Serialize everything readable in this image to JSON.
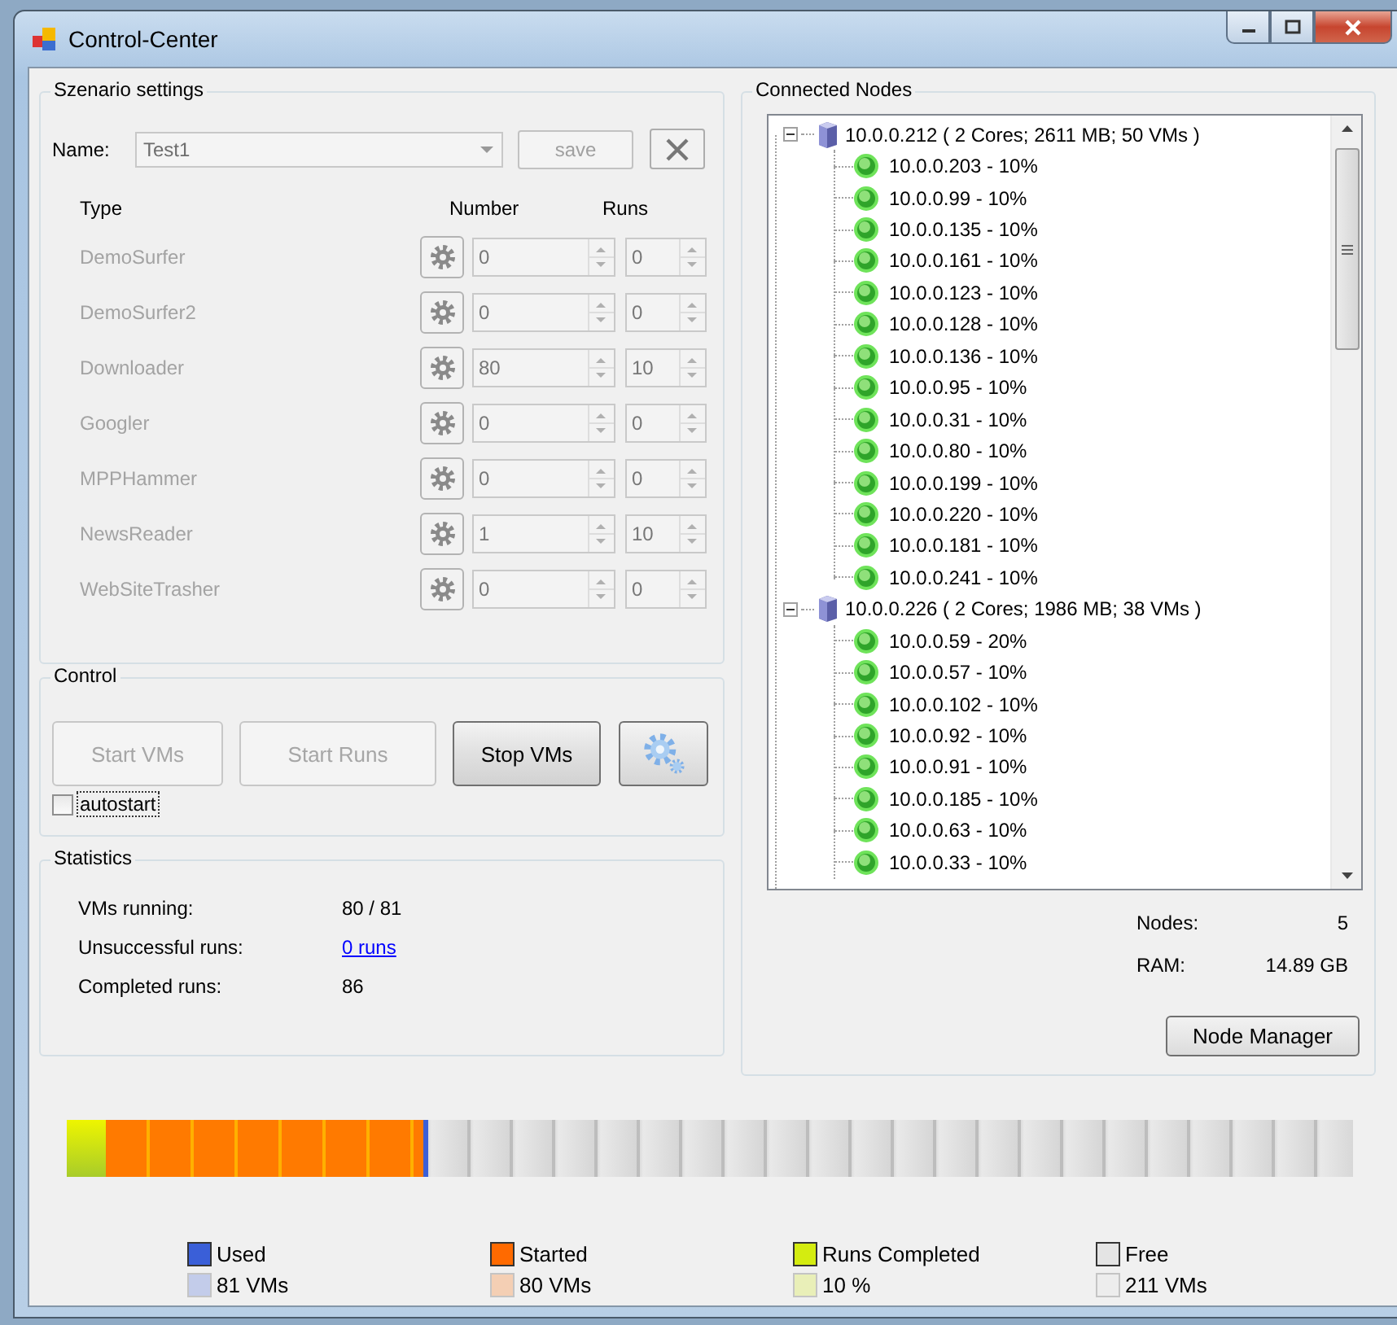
{
  "window": {
    "title": "Control-Center"
  },
  "scenario": {
    "title": "Szenario settings",
    "name_label": "Name:",
    "name_value": "Test1",
    "save_button": {
      "label": "save",
      "disabled": true
    },
    "columns": [
      "Type",
      "Number",
      "Runs"
    ],
    "rows": [
      {
        "type": "DemoSurfer",
        "number": "0",
        "runs": "0",
        "disabled": true
      },
      {
        "type": "DemoSurfer2",
        "number": "0",
        "runs": "0",
        "disabled": true
      },
      {
        "type": "Downloader",
        "number": "80",
        "runs": "10",
        "disabled": true
      },
      {
        "type": "Googler",
        "number": "0",
        "runs": "0",
        "disabled": true
      },
      {
        "type": "MPPHammer",
        "number": "0",
        "runs": "0",
        "disabled": true
      },
      {
        "type": "NewsReader",
        "number": "1",
        "runs": "10",
        "disabled": true
      },
      {
        "type": "WebSiteTrasher",
        "number": "0",
        "runs": "0",
        "disabled": true
      }
    ]
  },
  "control": {
    "title": "Control",
    "buttons": [
      {
        "label": "Start VMs",
        "disabled": true
      },
      {
        "label": "Start Runs",
        "disabled": true
      },
      {
        "label": "Stop VMs",
        "disabled": false
      }
    ],
    "autostart": {
      "label": "autostart",
      "checked": false
    }
  },
  "statistics": {
    "title": "Statistics",
    "rows": [
      {
        "label": "VMs running:",
        "value": "80 / 81",
        "kind": "text"
      },
      {
        "label": "Unsuccessful runs:",
        "value": "0 runs",
        "kind": "link"
      },
      {
        "label": "Completed runs:",
        "value": "86",
        "kind": "text"
      }
    ]
  },
  "nodes": {
    "title": "Connected Nodes",
    "tree": [
      {
        "label": "10.0.0.212 ( 2 Cores; 2611 MB; 50 VMs )",
        "expanded": true,
        "children": [
          {
            "label": "10.0.0.203 - 10%"
          },
          {
            "label": "10.0.0.99 - 10%"
          },
          {
            "label": "10.0.0.135 - 10%"
          },
          {
            "label": "10.0.0.161 - 10%"
          },
          {
            "label": "10.0.0.123 - 10%"
          },
          {
            "label": "10.0.0.128 - 10%"
          },
          {
            "label": "10.0.0.136 - 10%"
          },
          {
            "label": "10.0.0.95 - 10%"
          },
          {
            "label": "10.0.0.31 - 10%"
          },
          {
            "label": "10.0.0.80 - 10%"
          },
          {
            "label": "10.0.0.199 - 10%"
          },
          {
            "label": "10.0.0.220 - 10%"
          },
          {
            "label": "10.0.0.181 - 10%"
          },
          {
            "label": "10.0.0.241 - 10%"
          }
        ]
      },
      {
        "label": "10.0.0.226 ( 2 Cores; 1986 MB; 38 VMs )",
        "expanded": true,
        "children": [
          {
            "label": "10.0.0.59 - 20%"
          },
          {
            "label": "10.0.0.57 - 10%"
          },
          {
            "label": "10.0.0.102 - 10%"
          },
          {
            "label": "10.0.0.92 - 10%"
          },
          {
            "label": "10.0.0.91 - 10%"
          },
          {
            "label": "10.0.0.185 - 10%"
          },
          {
            "label": "10.0.0.63 - 10%"
          },
          {
            "label": "10.0.0.33 - 10%"
          }
        ]
      }
    ],
    "summary": [
      {
        "label": "Nodes:",
        "value": "5"
      },
      {
        "label": "RAM:",
        "value": "14.89 GB"
      }
    ],
    "button": "Node Manager"
  },
  "capacity_bar": [
    {
      "kind": "completed"
    },
    {
      "kind": "started"
    },
    {
      "kind": "used"
    },
    {
      "kind": "free"
    }
  ],
  "legend": [
    {
      "label": "Used",
      "value": "81 VMs",
      "color": "#3a5fd8"
    },
    {
      "label": "Started",
      "value": "80 VMs",
      "color": "#ff6a00"
    },
    {
      "label": "Runs Completed",
      "value": "10 %",
      "color": "#d4ec10"
    },
    {
      "label": "Free",
      "value": "211 VMs",
      "color": "#e4e4e4"
    }
  ]
}
